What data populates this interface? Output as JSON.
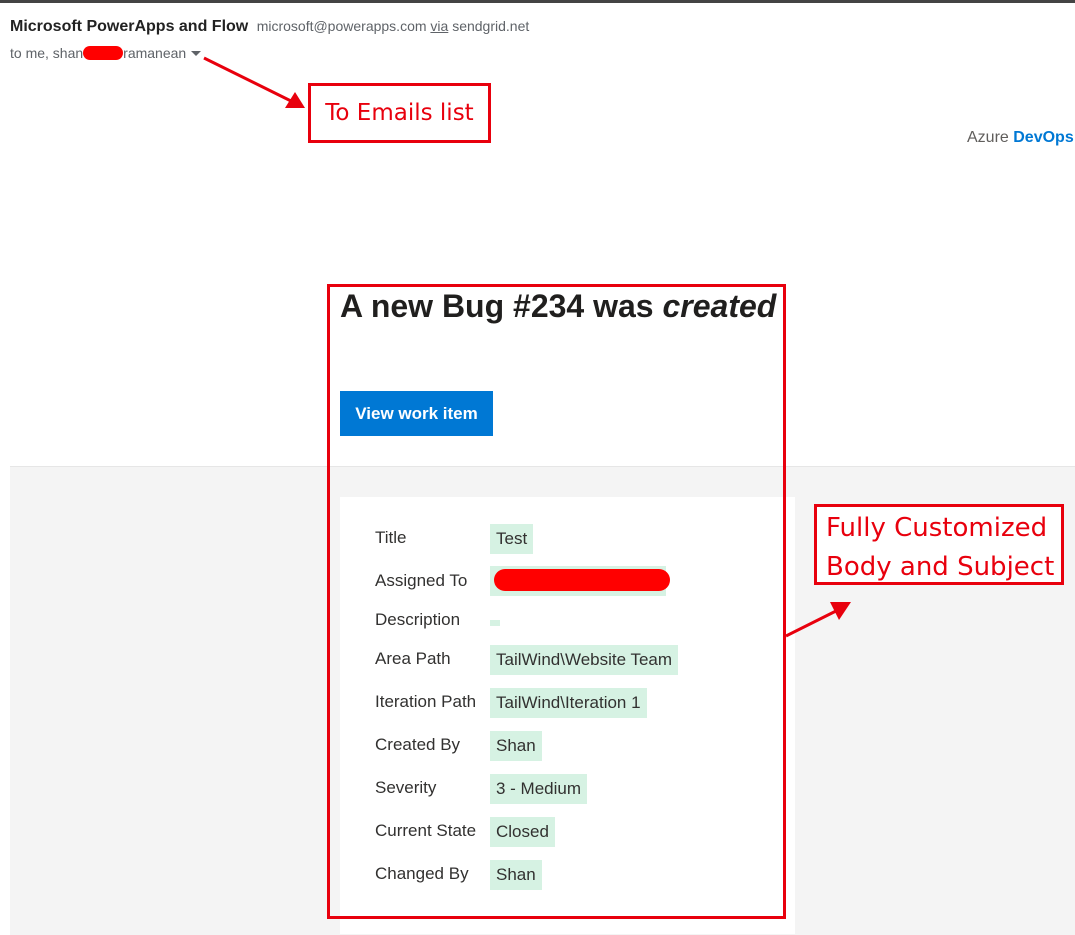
{
  "header": {
    "sender_name": "Microsoft PowerApps and Flow",
    "sender_email": "microsoft@powerapps.com",
    "via_label": "via",
    "via_domain": "sendgrid.net",
    "to_prefix": "to me, shan",
    "to_suffix": "ramanean",
    "redaction_color": "#ff0000"
  },
  "brand": {
    "azure": "Azure",
    "devops": "DevOps"
  },
  "email": {
    "headline_prefix": "A new Bug #234 was",
    "headline_emphasis": "created",
    "button_label": "View work item",
    "fields": [
      {
        "label": "Title",
        "value": "Test"
      },
      {
        "label": "Assigned To",
        "value": ""
      },
      {
        "label": "Description",
        "value": ""
      },
      {
        "label": "Area Path",
        "value": "TailWind\\Website Team"
      },
      {
        "label": "Iteration Path",
        "value": "TailWind\\Iteration 1"
      },
      {
        "label": "Created By",
        "value": "Shan"
      },
      {
        "label": "Severity",
        "value": "3 - Medium"
      },
      {
        "label": "Current State",
        "value": "Closed"
      },
      {
        "label": "Changed By",
        "value": "Shan"
      }
    ]
  },
  "annotations": {
    "to_emails": "To Emails list",
    "custom_line1": "Fully Customized",
    "custom_line2": "Body and Subject",
    "color": "#e8000d"
  },
  "colors": {
    "accent": "#0078d4",
    "field_value_bg": "#d6f2e3",
    "body_bg": "#f4f4f4"
  }
}
